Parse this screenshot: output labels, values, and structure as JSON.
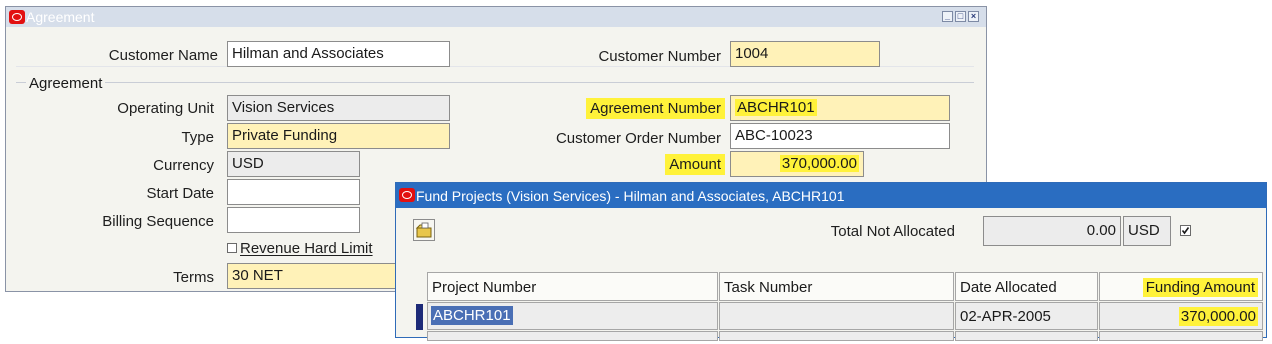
{
  "agreement_window": {
    "title": "Agreement",
    "customer_name_label": "Customer Name",
    "customer_name_value": "Hilman and Associates",
    "customer_number_label": "Customer Number",
    "customer_number_value": "1004",
    "section_label": "Agreement",
    "operating_unit_label": "Operating Unit",
    "operating_unit_value": "Vision Services",
    "type_label": "Type",
    "type_value": "Private Funding",
    "currency_label": "Currency",
    "currency_value": "USD",
    "start_date_label": "Start Date",
    "start_date_value": "",
    "billing_sequence_label": "Billing Sequence",
    "billing_sequence_value": "",
    "revenue_hard_limit_label": "Revenue Hard Limit",
    "terms_label": "Terms",
    "terms_value": "30 NET",
    "agreement_number_label": "Agreement Number",
    "agreement_number_value": "ABCHR101",
    "customer_order_number_label": "Customer Order Number",
    "customer_order_number_value": "ABC-10023",
    "amount_label": "Amount",
    "amount_value": "370,000.00",
    "window_buttons": [
      "minimize",
      "restore",
      "close"
    ]
  },
  "fund_projects_window": {
    "title": "Fund Projects (Vision Services) - Hilman and Associates, ABCHR101",
    "total_not_allocated_label": "Total Not Allocated",
    "total_not_allocated_value": "0.00",
    "currency_value": "USD",
    "columns": [
      "Project Number",
      "Task Number",
      "Date Allocated",
      "Funding Amount"
    ],
    "rows": [
      {
        "project_number": "ABCHR101",
        "task_number": "",
        "date_allocated": "02-APR-2005",
        "funding_amount": "370,000.00"
      }
    ]
  },
  "colors": {
    "highlight": "#fff23a",
    "required_field": "#fff2b8",
    "title_bar_active": "#2a6dc1",
    "title_bar_inactive": "#d6deea",
    "oracle_icon": "#e21010"
  }
}
